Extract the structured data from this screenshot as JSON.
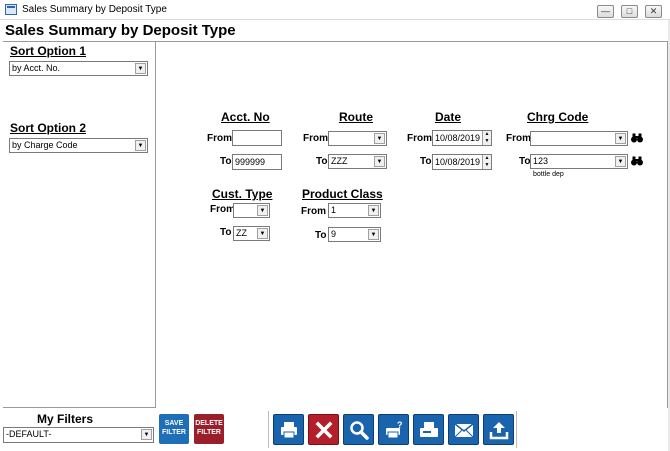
{
  "window": {
    "title": "Sales Summary by Deposit Type",
    "controls": {
      "minimize": "—",
      "maximize": "□",
      "close": "✕"
    }
  },
  "page": {
    "title": "Sales Summary by Deposit Type"
  },
  "sort": {
    "option1_label": "Sort Option 1",
    "option1_value": "by Acct. No.",
    "option2_label": "Sort Option 2",
    "option2_value": "by Charge Code"
  },
  "filters": {
    "acct_no": {
      "title": "Acct. No",
      "from_label": "From",
      "to_label": "To",
      "from": "",
      "to": "999999"
    },
    "route": {
      "title": "Route",
      "from_label": "From",
      "to_label": "To",
      "from": "",
      "to": "ZZZ"
    },
    "date": {
      "title": "Date",
      "from_label": "From",
      "to_label": "To",
      "from": "10/08/2019",
      "to": "10/08/2019"
    },
    "chrg_code": {
      "title": "Chrg Code",
      "from_label": "From",
      "to_label": "To",
      "from": "",
      "to": "123",
      "to_hint": "bottle dep"
    },
    "cust_type": {
      "title": "Cust. Type",
      "from_label": "From",
      "to_label": "To",
      "from": "",
      "to": "ZZ"
    },
    "product_class": {
      "title": "Product Class",
      "from_label": "From",
      "to_label": "To",
      "from": "1",
      "to": "9"
    }
  },
  "my_filters": {
    "label": "My Filters",
    "value": "-DEFAULT-",
    "save_line1": "SAVE",
    "save_line2": "FILTER",
    "delete_line1": "DELETE",
    "delete_line2": "FILTER"
  },
  "toolbar": {
    "icons": [
      "print-icon",
      "cancel-icon",
      "preview-icon",
      "print-setup-icon",
      "fax-icon",
      "email-icon",
      "export-icon"
    ]
  },
  "colors": {
    "blue_button": "#1a64ad",
    "red_button": "#b4202a",
    "save_filter": "#1f6fb8",
    "delete_filter": "#9b1f2a"
  }
}
